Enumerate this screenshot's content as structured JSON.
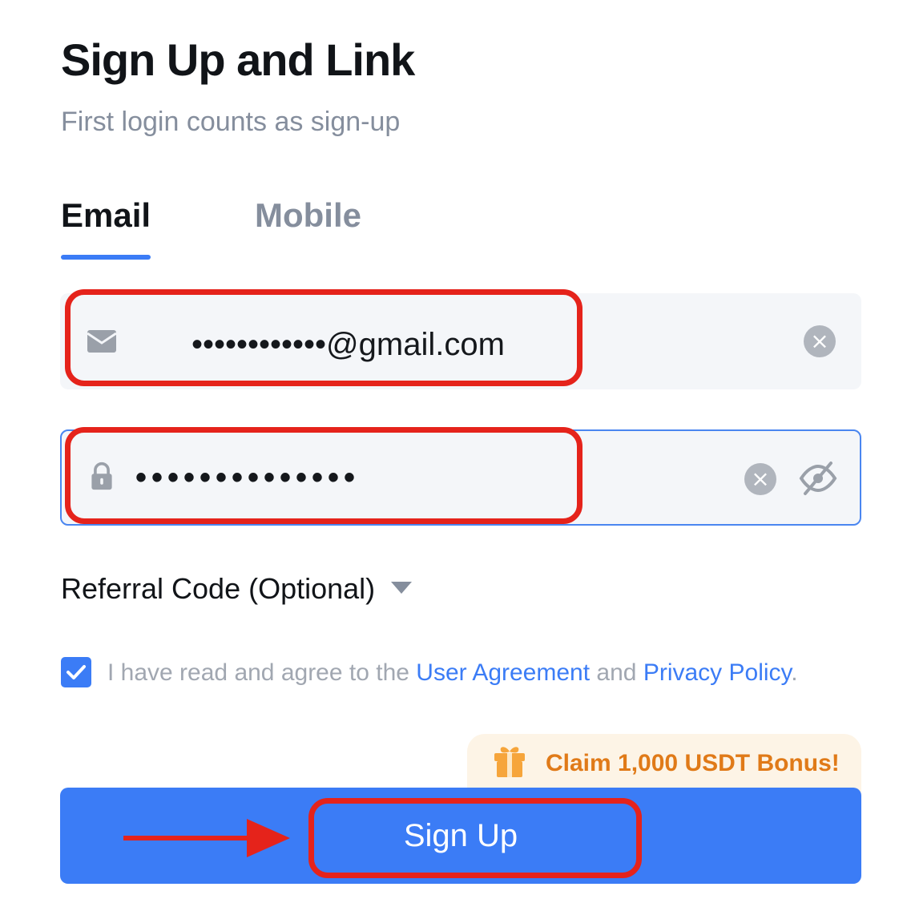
{
  "header": {
    "title": "Sign Up and Link",
    "subtitle": "First login counts as sign-up"
  },
  "tabs": [
    {
      "label": "Email",
      "active": true
    },
    {
      "label": "Mobile",
      "active": false
    }
  ],
  "email_field": {
    "icon": "envelope-icon",
    "value": "••••••••••••@gmail.com"
  },
  "password_field": {
    "icon": "lock-icon",
    "value": "••••••••••••••"
  },
  "referral": {
    "label": "Referral Code (Optional)"
  },
  "agreement": {
    "checked": true,
    "prefix": "I have read and agree to the ",
    "user_agreement": "User Agreement",
    "conjunction": " and ",
    "privacy_policy": "Privacy Policy",
    "suffix": "."
  },
  "bonus": {
    "text": "Claim 1,000 USDT Bonus!"
  },
  "signup_button": {
    "label": "Sign Up"
  },
  "colors": {
    "accent": "#3b7cf6",
    "highlight": "#e5231b",
    "bonus": "#e07a18"
  }
}
